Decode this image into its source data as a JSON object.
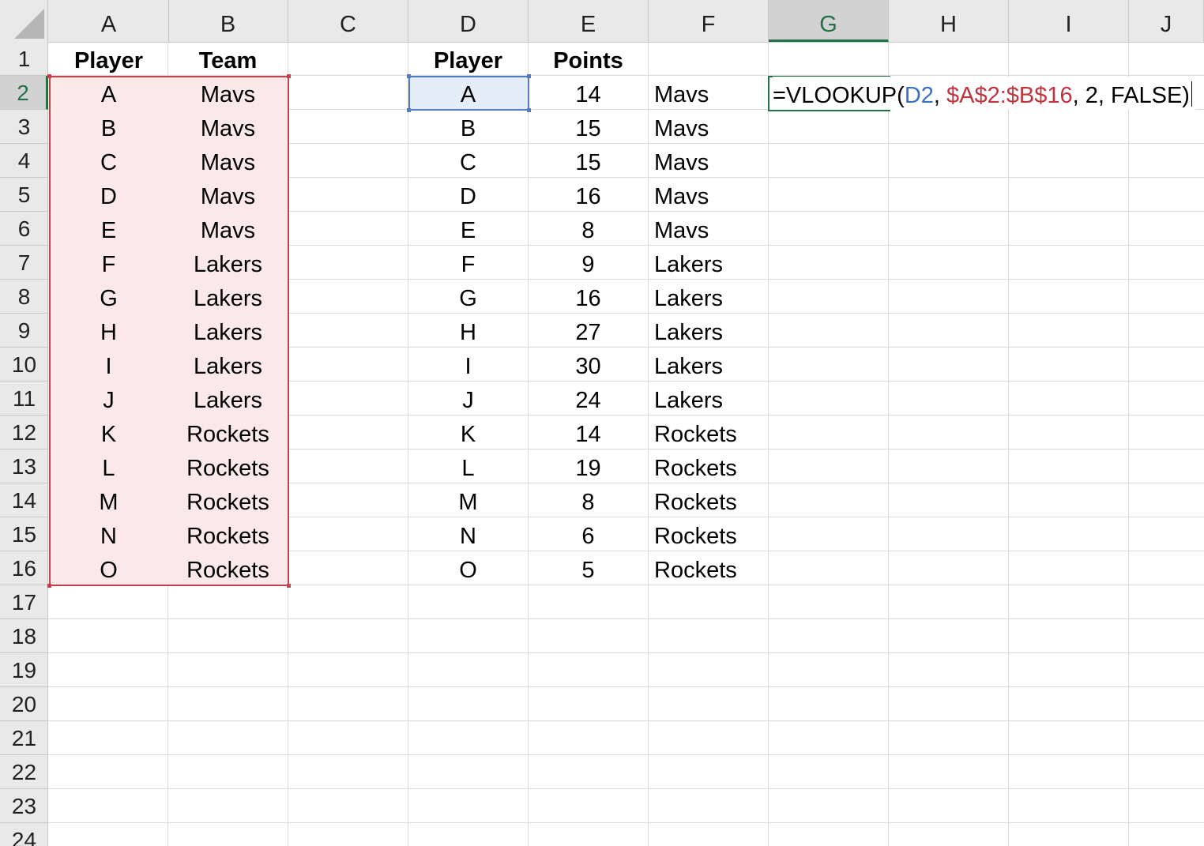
{
  "columns": [
    "A",
    "B",
    "C",
    "D",
    "E",
    "F",
    "G",
    "H",
    "I",
    "J"
  ],
  "active_column": "G",
  "rows": [
    "1",
    "2",
    "3",
    "4",
    "5",
    "6",
    "7",
    "8",
    "9",
    "10",
    "11",
    "12",
    "13",
    "14",
    "15",
    "16",
    "17",
    "18",
    "19",
    "20",
    "21",
    "22",
    "23",
    "24"
  ],
  "active_row": "2",
  "table1": {
    "headers": {
      "player": "Player",
      "team": "Team"
    },
    "players": [
      "A",
      "B",
      "C",
      "D",
      "E",
      "F",
      "G",
      "H",
      "I",
      "J",
      "K",
      "L",
      "M",
      "N",
      "O"
    ],
    "teams": [
      "Mavs",
      "Mavs",
      "Mavs",
      "Mavs",
      "Mavs",
      "Lakers",
      "Lakers",
      "Lakers",
      "Lakers",
      "Lakers",
      "Rockets",
      "Rockets",
      "Rockets",
      "Rockets",
      "Rockets"
    ]
  },
  "table2": {
    "headers": {
      "player": "Player",
      "points": "Points"
    },
    "players": [
      "A",
      "B",
      "C",
      "D",
      "E",
      "F",
      "G",
      "H",
      "I",
      "J",
      "K",
      "L",
      "M",
      "N",
      "O"
    ],
    "points": [
      "14",
      "15",
      "15",
      "16",
      "8",
      "9",
      "16",
      "27",
      "30",
      "24",
      "14",
      "19",
      "8",
      "6",
      "5"
    ],
    "teams_lookup": [
      "Mavs",
      "Mavs",
      "Mavs",
      "Mavs",
      "Mavs",
      "Lakers",
      "Lakers",
      "Lakers",
      "Lakers",
      "Lakers",
      "Rockets",
      "Rockets",
      "Rockets",
      "Rockets",
      "Rockets"
    ]
  },
  "formula": {
    "prefix": "=VLOOKUP(",
    "ref_lookup": "D2",
    "sep1": ", ",
    "ref_range": "$A$2:$B$16",
    "suffix": ", 2, FALSE)"
  },
  "colors": {
    "accent_green": "#217346",
    "range_red": "#c2434e",
    "range_fill": "#fbe9ea",
    "ref_blue": "#4f7cc4",
    "ref_fill": "#e5edf8"
  }
}
